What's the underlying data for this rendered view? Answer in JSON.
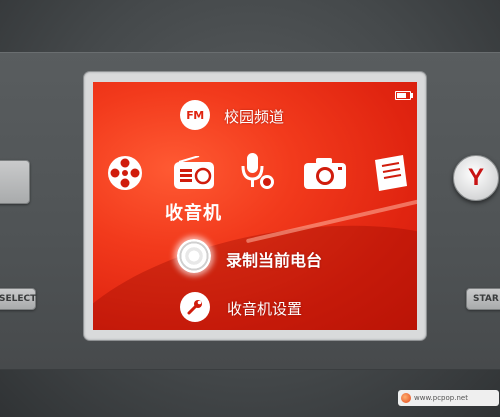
{
  "screen": {
    "fm_badge": "FM",
    "campus_channel_label": "校园频道",
    "active_app_label": "收音机",
    "record_label": "录制当前电台",
    "settings_label": "收音机设置",
    "icons": [
      "film-reel-icon",
      "radio-icon",
      "microphone-icon",
      "camera-icon",
      "notebook-icon"
    ],
    "colors": {
      "background": "#e02410",
      "highlight": "#ffffff"
    }
  },
  "device": {
    "y_button_label": "Y",
    "select_button_label": "SELECT",
    "start_button_label": "STAR"
  },
  "watermark": {
    "text": "www.pcpop.net"
  }
}
